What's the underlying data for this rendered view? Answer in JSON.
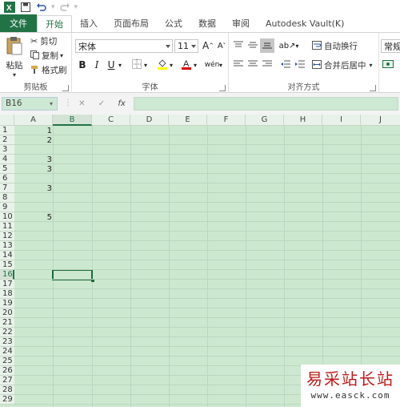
{
  "tabs": [
    "文件",
    "开始",
    "插入",
    "页面布局",
    "公式",
    "数据",
    "审阅",
    "Autodesk Vault(K)"
  ],
  "clipboard": {
    "paste_label": "粘贴",
    "cut_label": "剪切",
    "copy_label": "复制",
    "format_painter_label": "格式刷",
    "group_label": "剪贴板"
  },
  "font": {
    "name": "宋体",
    "size": "11",
    "bold": "B",
    "italic": "I",
    "underline": "U",
    "grow": "A",
    "shrink": "A",
    "group_label": "字体"
  },
  "alignment": {
    "wrap_label": "自动换行",
    "merge_label": "合并后居中",
    "group_label": "对齐方式"
  },
  "number": {
    "format": "常规"
  },
  "formula_bar": {
    "name_box": "B16",
    "cancel": "✕",
    "enter": "✓",
    "fx": "fx",
    "content": ""
  },
  "columns": [
    "A",
    "B",
    "C",
    "D",
    "E",
    "F",
    "G",
    "H",
    "I",
    "J"
  ],
  "selected_column": "B",
  "rows": [
    "1",
    "2",
    "3",
    "4",
    "5",
    "6",
    "7",
    "8",
    "9",
    "10",
    "11",
    "12",
    "13",
    "14",
    "15",
    "16",
    "17",
    "18",
    "19",
    "20",
    "21",
    "22",
    "23",
    "24",
    "25",
    "26",
    "27",
    "28",
    "29"
  ],
  "selected_row": "16",
  "cells": {
    "a1": "1",
    "a2": "2",
    "a4": "3",
    "a5": "3",
    "a7": "3",
    "a10": "5"
  },
  "watermark": {
    "title": "易采站长站",
    "url": "www.easck.com"
  },
  "colors": {
    "accent": "#217346",
    "sheet_bg": "#cce8cf"
  }
}
